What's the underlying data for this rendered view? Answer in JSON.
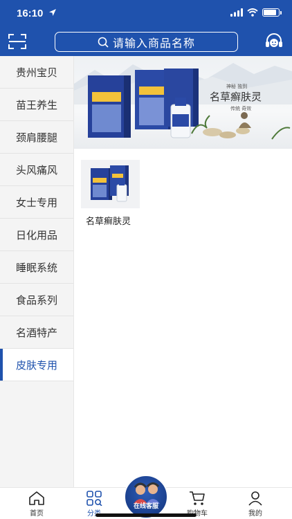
{
  "status_bar": {
    "time": "16:10"
  },
  "header": {
    "search_placeholder": "请输入商品名称",
    "accent_color": "#1f52ad",
    "left_icon": "scan-icon",
    "right_icon": "customer-service-icon"
  },
  "sidebar": {
    "items": [
      {
        "label": "贵州宝贝"
      },
      {
        "label": "苗王养生"
      },
      {
        "label": "颈肩腰腿"
      },
      {
        "label": "头风痛风"
      },
      {
        "label": "女士专用"
      },
      {
        "label": "日化用品"
      },
      {
        "label": "睡眠系统"
      },
      {
        "label": "食品系列"
      },
      {
        "label": "名酒特产"
      },
      {
        "label": "皮肤专用"
      }
    ],
    "active": "皮肤专用"
  },
  "banner": {
    "title": "名草癣肤灵",
    "line1": "神秘 独到",
    "line2": "传统 奇效"
  },
  "products": [
    {
      "name": "名草癣肤灵"
    }
  ],
  "tabbar": {
    "items": [
      {
        "label": "首页",
        "icon": "home-icon"
      },
      {
        "label": "分类",
        "icon": "category-icon"
      },
      {
        "label": "在线客服",
        "icon": "customer-service-icon"
      },
      {
        "label": "购物车",
        "icon": "cart-icon"
      },
      {
        "label": "我的",
        "icon": "user-icon"
      }
    ],
    "active": "分类"
  }
}
